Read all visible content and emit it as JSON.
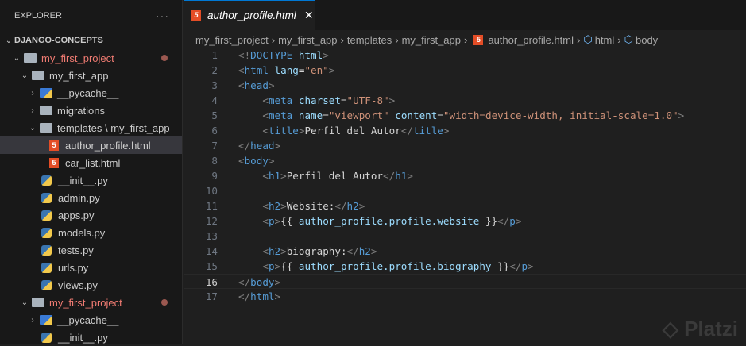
{
  "explorer": {
    "title": "EXPLORER",
    "more": "···",
    "root": "DJANGO-CONCEPTS",
    "items": [
      {
        "label": "my_first_project",
        "level": 1,
        "kind": "folder",
        "open": true,
        "red": true,
        "dot": true
      },
      {
        "label": "my_first_app",
        "level": 2,
        "kind": "folder",
        "open": true
      },
      {
        "label": "__pycache__",
        "level": 3,
        "kind": "pyc",
        "open": false
      },
      {
        "label": "migrations",
        "level": 3,
        "kind": "folder",
        "open": false
      },
      {
        "label": "templates \\ my_first_app",
        "level": 3,
        "kind": "folder",
        "open": true
      },
      {
        "label": "author_profile.html",
        "level": 4,
        "kind": "html",
        "selected": true
      },
      {
        "label": "car_list.html",
        "level": 4,
        "kind": "html"
      },
      {
        "label": "__init__.py",
        "level": 3,
        "kind": "py"
      },
      {
        "label": "admin.py",
        "level": 3,
        "kind": "py"
      },
      {
        "label": "apps.py",
        "level": 3,
        "kind": "py"
      },
      {
        "label": "models.py",
        "level": 3,
        "kind": "py"
      },
      {
        "label": "tests.py",
        "level": 3,
        "kind": "py"
      },
      {
        "label": "urls.py",
        "level": 3,
        "kind": "py"
      },
      {
        "label": "views.py",
        "level": 3,
        "kind": "py"
      },
      {
        "label": "my_first_project",
        "level": 2,
        "kind": "folder",
        "open": true,
        "red": true,
        "dot": true
      },
      {
        "label": "__pycache__",
        "level": 3,
        "kind": "pyc",
        "open": false
      },
      {
        "label": "__init__.py",
        "level": 3,
        "kind": "py"
      }
    ]
  },
  "tab": {
    "label": "author_profile.html",
    "close": "✕",
    "icon": "5"
  },
  "breadcrumb": [
    "my_first_project",
    "my_first_app",
    "templates",
    "my_first_app",
    "author_profile.html",
    "html",
    "body"
  ],
  "current_line": 16,
  "code": [
    [
      [
        "b",
        "<!"
      ],
      [
        "t",
        "DOCTYPE"
      ],
      [
        "x",
        " "
      ],
      [
        "a",
        "html"
      ],
      [
        "b",
        ">"
      ]
    ],
    [
      [
        "b",
        "<"
      ],
      [
        "t",
        "html"
      ],
      [
        "x",
        " "
      ],
      [
        "a",
        "lang"
      ],
      [
        "x",
        "="
      ],
      [
        "s",
        "\"en\""
      ],
      [
        "b",
        ">"
      ]
    ],
    [
      [
        "b",
        "<"
      ],
      [
        "t",
        "head"
      ],
      [
        "b",
        ">"
      ]
    ],
    [
      [
        "x",
        "    "
      ],
      [
        "b",
        "<"
      ],
      [
        "t",
        "meta"
      ],
      [
        "x",
        " "
      ],
      [
        "a",
        "charset"
      ],
      [
        "x",
        "="
      ],
      [
        "s",
        "\"UTF-8\""
      ],
      [
        "b",
        ">"
      ]
    ],
    [
      [
        "x",
        "    "
      ],
      [
        "b",
        "<"
      ],
      [
        "t",
        "meta"
      ],
      [
        "x",
        " "
      ],
      [
        "a",
        "name"
      ],
      [
        "x",
        "="
      ],
      [
        "s",
        "\"viewport\""
      ],
      [
        "x",
        " "
      ],
      [
        "a",
        "content"
      ],
      [
        "x",
        "="
      ],
      [
        "s",
        "\"width=device-width, initial-scale=1.0\""
      ],
      [
        "b",
        ">"
      ]
    ],
    [
      [
        "x",
        "    "
      ],
      [
        "b",
        "<"
      ],
      [
        "t",
        "title"
      ],
      [
        "b",
        ">"
      ],
      [
        "x",
        "Perfil del Autor"
      ],
      [
        "b",
        "</"
      ],
      [
        "t",
        "title"
      ],
      [
        "b",
        ">"
      ]
    ],
    [
      [
        "b",
        "</"
      ],
      [
        "t",
        "head"
      ],
      [
        "b",
        ">"
      ]
    ],
    [
      [
        "b",
        "<"
      ],
      [
        "t",
        "body"
      ],
      [
        "b",
        ">"
      ]
    ],
    [
      [
        "x",
        "    "
      ],
      [
        "b",
        "<"
      ],
      [
        "t",
        "h1"
      ],
      [
        "b",
        ">"
      ],
      [
        "x",
        "Perfil del Autor"
      ],
      [
        "b",
        "</"
      ],
      [
        "t",
        "h1"
      ],
      [
        "b",
        ">"
      ]
    ],
    [],
    [
      [
        "x",
        "    "
      ],
      [
        "b",
        "<"
      ],
      [
        "t",
        "h2"
      ],
      [
        "b",
        ">"
      ],
      [
        "x",
        "Website:"
      ],
      [
        "b",
        "</"
      ],
      [
        "t",
        "h2"
      ],
      [
        "b",
        ">"
      ]
    ],
    [
      [
        "x",
        "    "
      ],
      [
        "b",
        "<"
      ],
      [
        "t",
        "p"
      ],
      [
        "b",
        ">"
      ],
      [
        "x",
        "{{ "
      ],
      [
        "a",
        "author_profile.profile.website"
      ],
      [
        "x",
        " }}"
      ],
      [
        "b",
        "</"
      ],
      [
        "t",
        "p"
      ],
      [
        "b",
        ">"
      ]
    ],
    [],
    [
      [
        "x",
        "    "
      ],
      [
        "b",
        "<"
      ],
      [
        "t",
        "h2"
      ],
      [
        "b",
        ">"
      ],
      [
        "x",
        "biography:"
      ],
      [
        "b",
        "</"
      ],
      [
        "t",
        "h2"
      ],
      [
        "b",
        ">"
      ]
    ],
    [
      [
        "x",
        "    "
      ],
      [
        "b",
        "<"
      ],
      [
        "t",
        "p"
      ],
      [
        "b",
        ">"
      ],
      [
        "x",
        "{{ "
      ],
      [
        "a",
        "author_profile.profile.biography"
      ],
      [
        "x",
        " }}"
      ],
      [
        "b",
        "</"
      ],
      [
        "t",
        "p"
      ],
      [
        "b",
        ">"
      ]
    ],
    [
      [
        "b",
        "</"
      ],
      [
        "t",
        "body"
      ],
      [
        "b",
        ">"
      ]
    ],
    [
      [
        "b",
        "</"
      ],
      [
        "t",
        "html"
      ],
      [
        "b",
        ">"
      ]
    ]
  ],
  "watermark": "Platzi"
}
